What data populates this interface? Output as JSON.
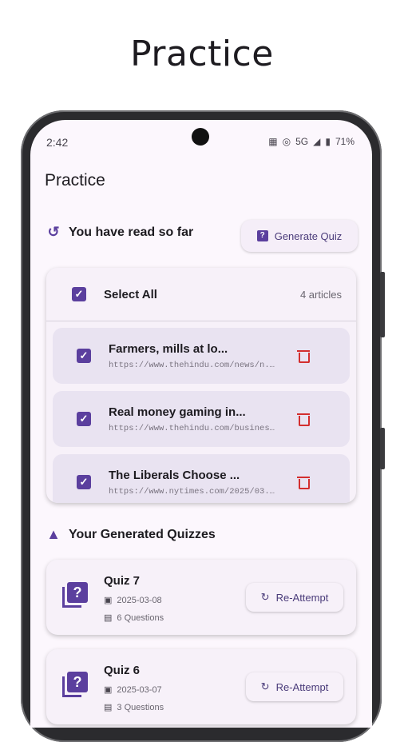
{
  "hero_title": "Practice",
  "status_bar": {
    "time": "2:42",
    "network": "5G",
    "battery": "71%"
  },
  "app_bar": {
    "title": "Practice"
  },
  "reading_section": {
    "heading": "You have read so far",
    "generate_button": "Generate Quiz",
    "select_all_label": "Select All",
    "article_count": "4 articles",
    "articles": [
      {
        "title": "Farmers, mills at lo...",
        "url": "https://www.thehindu.com/news/n..."
      },
      {
        "title": "Real money gaming in...",
        "url": "https://www.thehindu.com/busines..."
      },
      {
        "title": "The Liberals Choose ...",
        "url": "https://www.nytimes.com/2025/03..."
      }
    ]
  },
  "quizzes_section": {
    "heading": "Your Generated Quizzes",
    "reattempt_label": "Re-Attempt",
    "quizzes": [
      {
        "title": "Quiz 7",
        "date": "2025-03-08",
        "questions": "6 Questions"
      },
      {
        "title": "Quiz 6",
        "date": "2025-03-07",
        "questions": "3 Questions"
      }
    ]
  },
  "colors": {
    "accent": "#5b3f9e",
    "delete": "#d32f2f",
    "background": "#fcf7fd",
    "card": "#f7f1f9",
    "item": "#e9e3f1"
  },
  "icons": [
    "history-icon",
    "quiz-icon",
    "checkbox-checked-icon",
    "delete-icon",
    "school-icon",
    "calendar-icon",
    "questions-icon",
    "refresh-icon"
  ]
}
